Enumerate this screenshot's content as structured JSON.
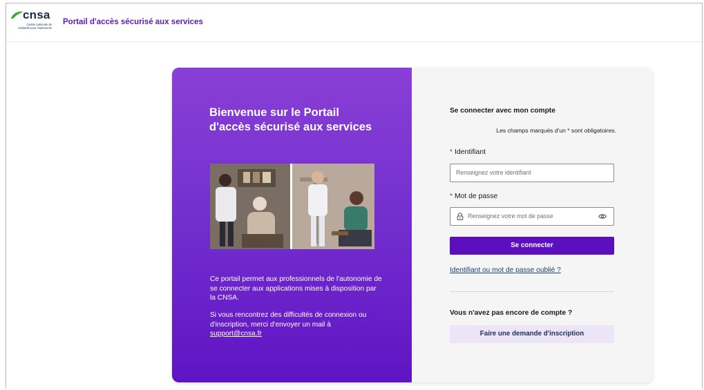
{
  "header": {
    "logo_text": "cnsa",
    "logo_subtitle_line1": "Caisse nationale de",
    "logo_subtitle_line2": "solidarité pour l'autonomie",
    "portal_title": "Portail d'accès sécurisé aux services"
  },
  "welcome_panel": {
    "title": "Bienvenue sur le Portail d'accès sécurisé aux services",
    "photo": "caregivers-assisting-elderly-photo",
    "info_paragraph_1": "Ce portail permet aux professionnels de l'autonomie de se connecter aux applications mises à disposition par la CNSA.",
    "info_paragraph_2": "Si vous rencontrez des difficultés de connexion ou d'inscription, merci d'envoyer un mail à",
    "support_email": "support@cnsa.fr"
  },
  "login": {
    "title": "Se connecter avec mon compte",
    "mandatory_note": "Les champs marqués d'un * sont obligatoires.",
    "required_marker": "*",
    "identifiant_label": "Identifiant",
    "identifiant_placeholder": "Renseignez votre identifiant",
    "password_label": "Mot de passe",
    "password_placeholder": "Renseignez votre mot de passe",
    "password_icon": "lock-icon",
    "show_password_icon": "eye-icon",
    "login_button": "Se connecter",
    "forgot_link": "Identifiant ou mot de passe oublié ?"
  },
  "signup": {
    "question": "Vous n'avez pas encore de compte ?",
    "button": "Faire une demande d'inscription"
  },
  "colors": {
    "brand_purple": "#5b0fbf",
    "panel_gradient_top": "#8a3fd6",
    "panel_gradient_bottom": "#5f14c3",
    "signup_button_bg": "#ece4f7",
    "logo_leaf_green": "#3aa935",
    "required_star": "#d3232f"
  }
}
